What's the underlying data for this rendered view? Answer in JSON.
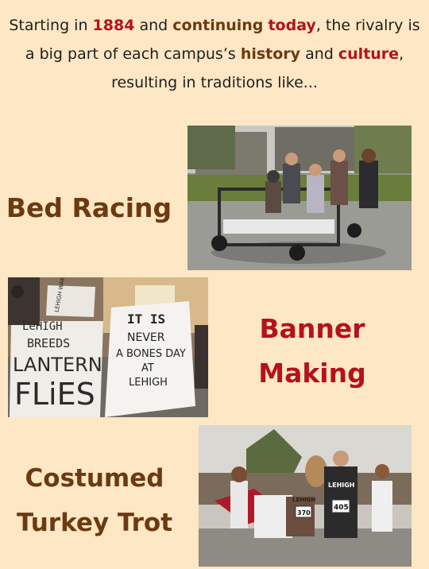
{
  "intro": {
    "p1": "Starting in ",
    "year": "1884",
    "p2": " and ",
    "continuing": "continuing",
    "p3": " ",
    "today": "today",
    "p4": ", the rivalry is a big part of each campus’s ",
    "history": "history",
    "p5": " and ",
    "culture": "culture",
    "p6": ", resulting in traditions like..."
  },
  "traditions": [
    {
      "label": "Bed Racing"
    },
    {
      "line1": "Banner",
      "line2": "Making"
    },
    {
      "line1": "Costumed",
      "line2": "Turkey Trot"
    }
  ],
  "banners": {
    "left_top": "LEHIGH WAKES THEN MOM LAFAYETTE",
    "left_main_1": "LeHIGH",
    "left_main_2": "BREEDS",
    "left_main_3": "LANTERN",
    "left_main_4": "FLiES",
    "right_1": "IT IS",
    "right_2": "NEVER",
    "right_3": "A BONES DAY",
    "right_4": "AT",
    "right_5": "LEHIGH"
  },
  "trot": {
    "bib1": "370",
    "bib2": "405",
    "shirt1": "LEHIGH",
    "shirt2": "LEHIGH"
  },
  "colors": {
    "background": "#fde7c4",
    "brown": "#6b3a12",
    "red": "#b5121b"
  }
}
